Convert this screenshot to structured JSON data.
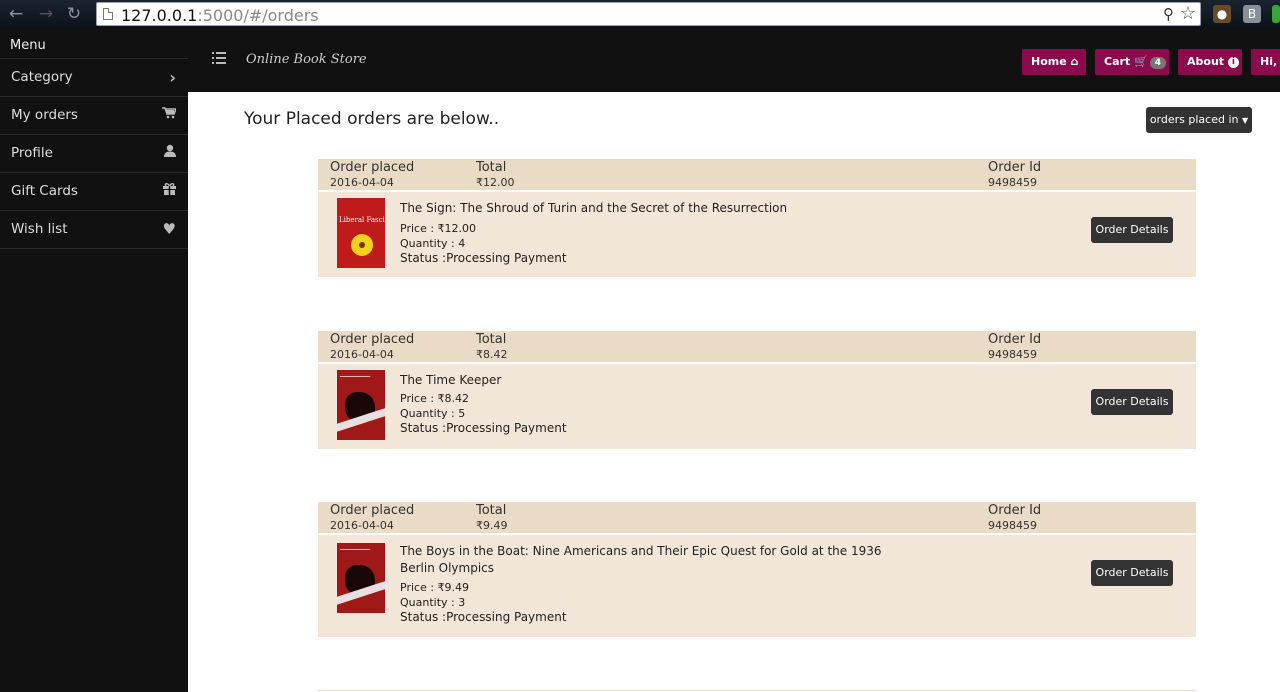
{
  "browser": {
    "url_host": "127.0.0.1",
    "url_path": ":5000/#/orders"
  },
  "sidebar": {
    "title": "Menu",
    "items": [
      {
        "label": "Category",
        "icon": "chevron-right-icon"
      },
      {
        "label": "My orders",
        "icon": "cart-icon"
      },
      {
        "label": "Profile",
        "icon": "user-icon"
      },
      {
        "label": "Gift Cards",
        "icon": "gift-icon"
      },
      {
        "label": "Wish list",
        "icon": "heart-icon"
      }
    ]
  },
  "navbar": {
    "brand": "Online Book Store",
    "home": "Home",
    "cart": "Cart",
    "cart_count": "4",
    "about": "About",
    "user": "Hi, S"
  },
  "main": {
    "heading": "Your Placed orders are below..",
    "filter": "orders placed in"
  },
  "labels": {
    "placed": "Order placed",
    "total": "Total",
    "order_id": "Order Id",
    "price_prefix": "Price : ",
    "qty_prefix": "Quantity : ",
    "status_prefix": "Status :",
    "details_button": "Order Details"
  },
  "orders": [
    {
      "date": "2016-04-04",
      "total": "₹12.00",
      "order_id": "9498459",
      "title": "The Sign: The Shroud of Turin and the Secret of the Resurrection",
      "price": "₹12.00",
      "quantity": "4",
      "status": "Processing Payment",
      "cover_text": "Liberal Fascis"
    },
    {
      "date": "2016-04-04",
      "total": "₹8.42",
      "order_id": "9498459",
      "title": "The Time Keeper",
      "price": "₹8.42",
      "quantity": "5",
      "status": "Processing Payment"
    },
    {
      "date": "2016-04-04",
      "total": "₹9.49",
      "order_id": "9498459",
      "title": "The Boys in the Boat: Nine Americans and Their Epic Quest for Gold at the 1936 Berlin Olympics",
      "price": "₹9.49",
      "quantity": "3",
      "status": "Processing Payment"
    }
  ]
}
